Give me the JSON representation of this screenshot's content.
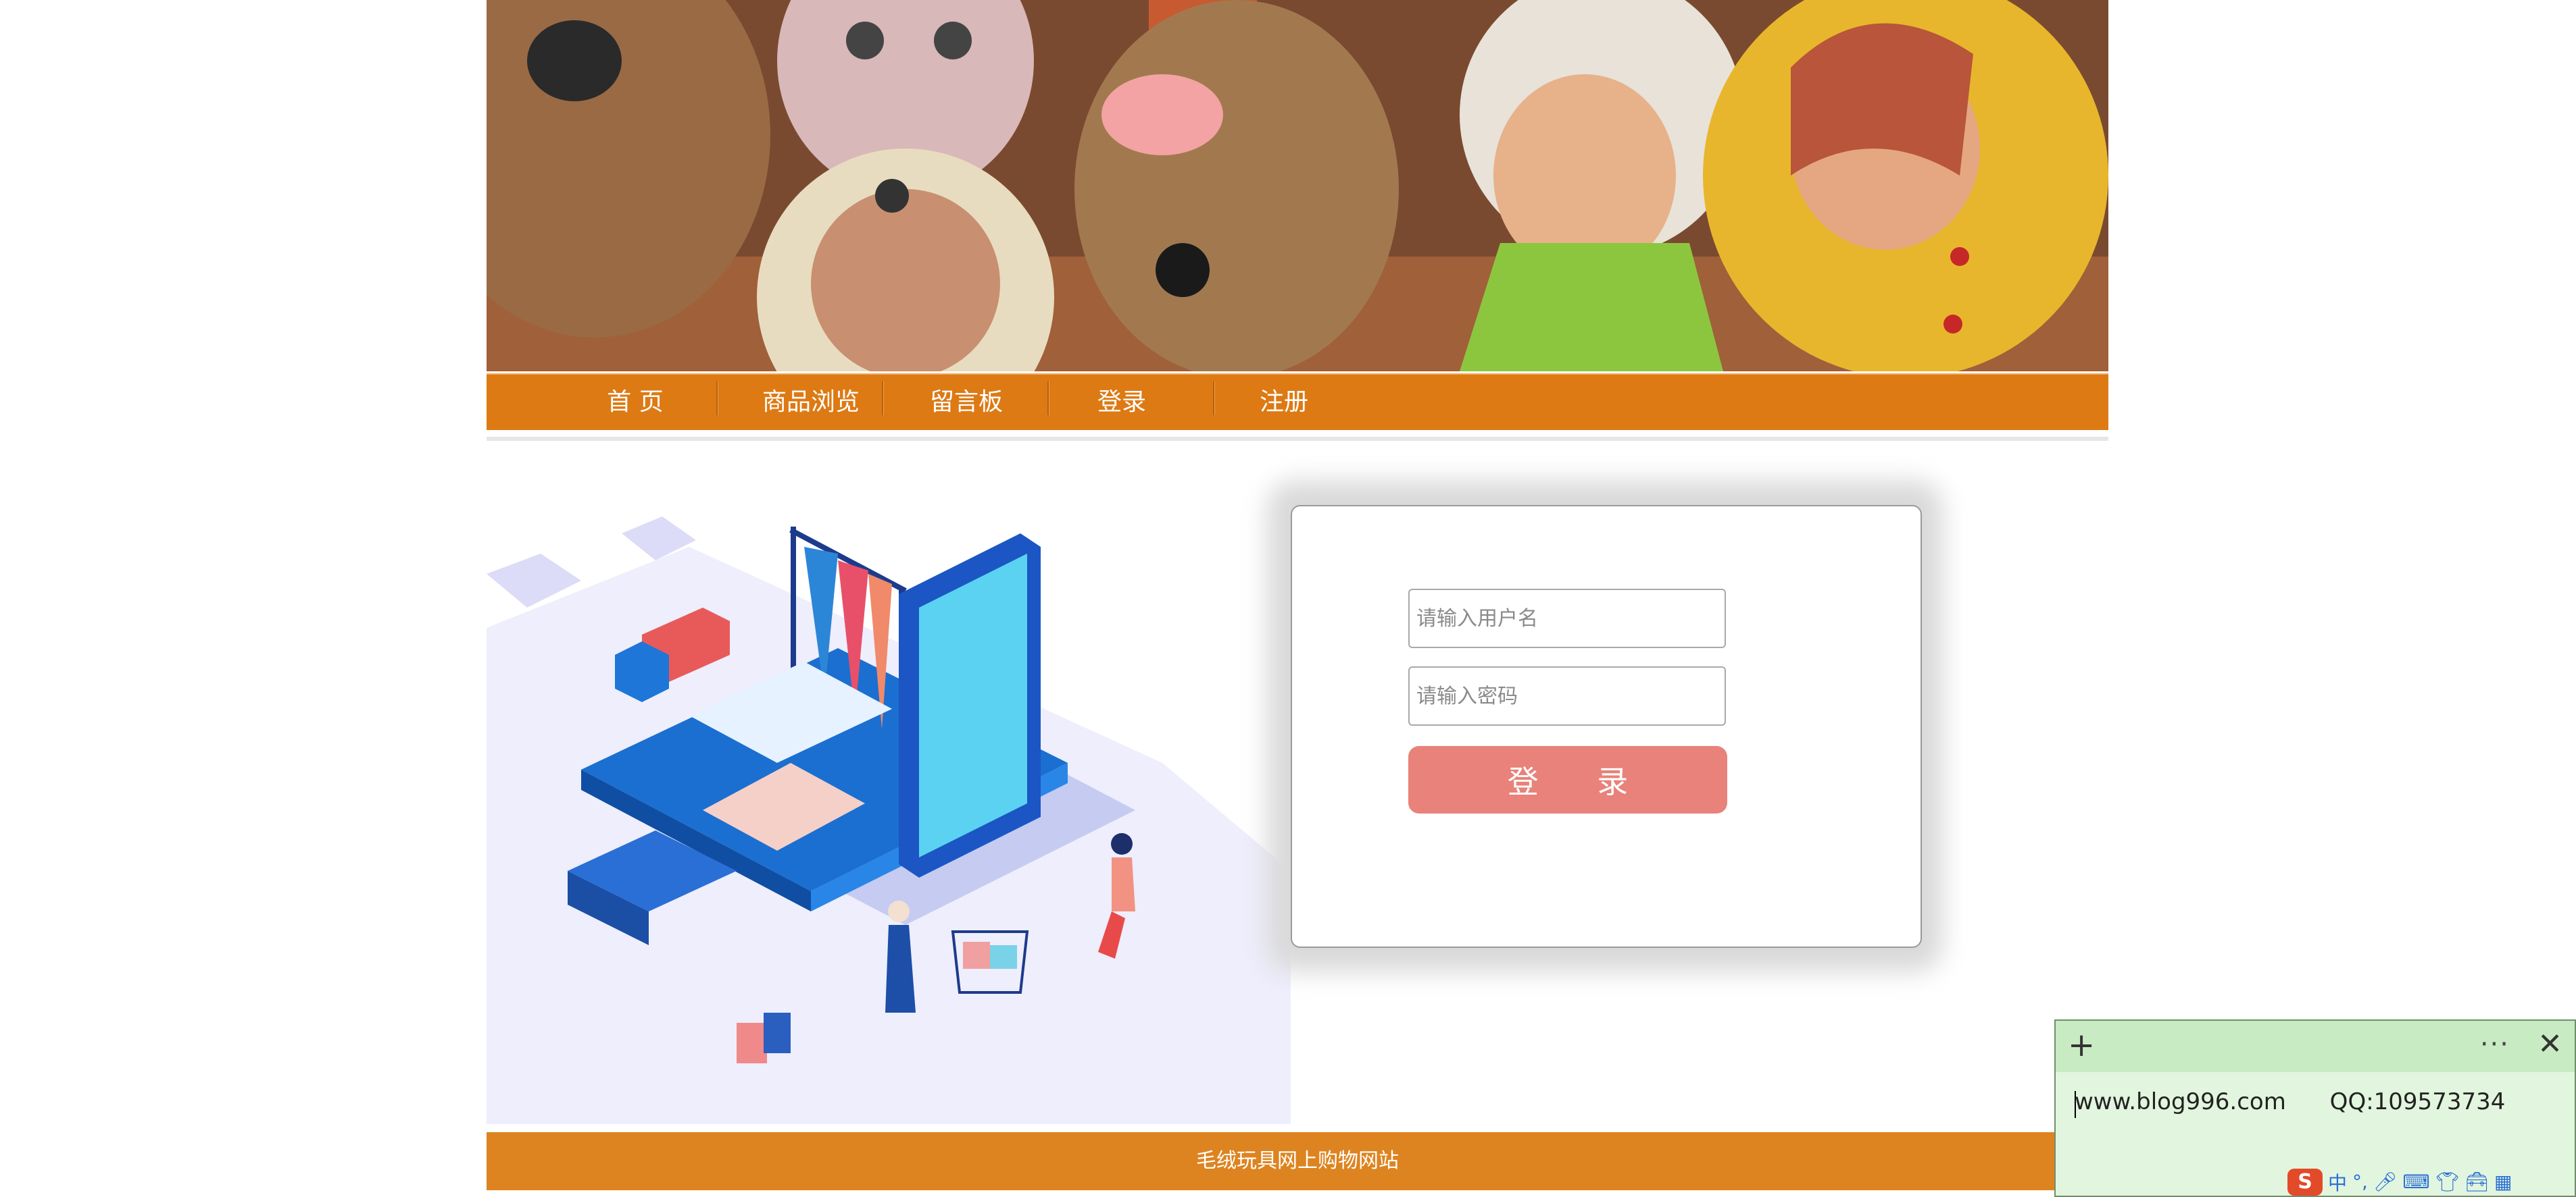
{
  "nav": {
    "items": [
      "首 页",
      "商品浏览",
      "留言板",
      "登录",
      "注册"
    ]
  },
  "login": {
    "username_placeholder": "请输入用户名",
    "password_placeholder": "请输入密码",
    "button_label": "登 录"
  },
  "footer": {
    "text": "毛绒玩具网上购物网站"
  },
  "note": {
    "text": "www.blog996.com      QQ:109573734",
    "plus": "+",
    "more": "···",
    "close": "✕"
  },
  "ime": {
    "logo": "S",
    "lang": "中",
    "icons": [
      "punctuation-icon",
      "microphone-icon",
      "keyboard-icon",
      "skin-icon",
      "toolbox-icon",
      "grid-icon"
    ]
  },
  "colors": {
    "nav": "#dd7a14",
    "footer": "#dd8420",
    "login_button": "#e8827a",
    "note_bg": "#e2f5de"
  }
}
